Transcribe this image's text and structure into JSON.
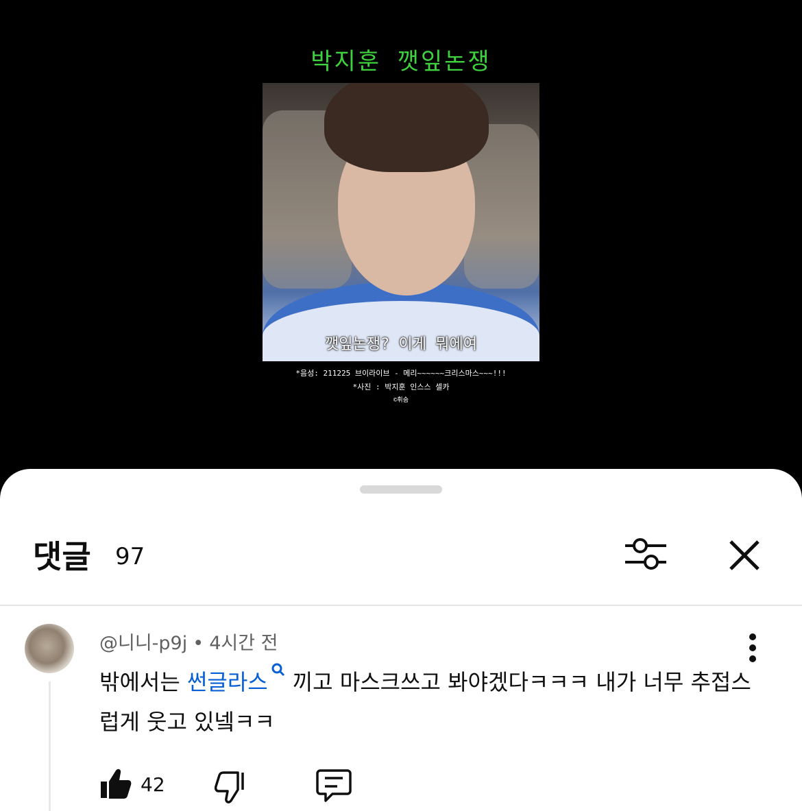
{
  "video": {
    "title": "박지훈 깻잎논쟁",
    "subtitle": "깻잎논쟁? 이게 뭐에여",
    "credits": [
      "*음성: 211225 브이라이브 - 메리~~~~~~크리스마스~~~!!!",
      "*사진 : 박지훈 인스스 셀카",
      "©휘숨"
    ]
  },
  "comments": {
    "title": "댓글",
    "count": "97",
    "items": [
      {
        "author": "@니니-p9j",
        "time": "4시간 전",
        "text_before": "밖에서는 ",
        "link_text": "썬글라스",
        "text_after": "끼고 마스크쓰고 봐야겠다ㅋㅋㅋ 내가 너무 추접스럽게 웃고 있넼ㅋㅋ",
        "likes": "42"
      }
    ]
  },
  "icons": {
    "filter": "sliders-icon",
    "close": "close-icon",
    "more": "more-vertical-icon",
    "like": "thumbs-up-icon",
    "dislike": "thumbs-down-icon",
    "reply": "reply-icon",
    "search": "search-icon"
  },
  "colors": {
    "title_green": "#3fd23f",
    "link_blue": "#065fd4"
  }
}
